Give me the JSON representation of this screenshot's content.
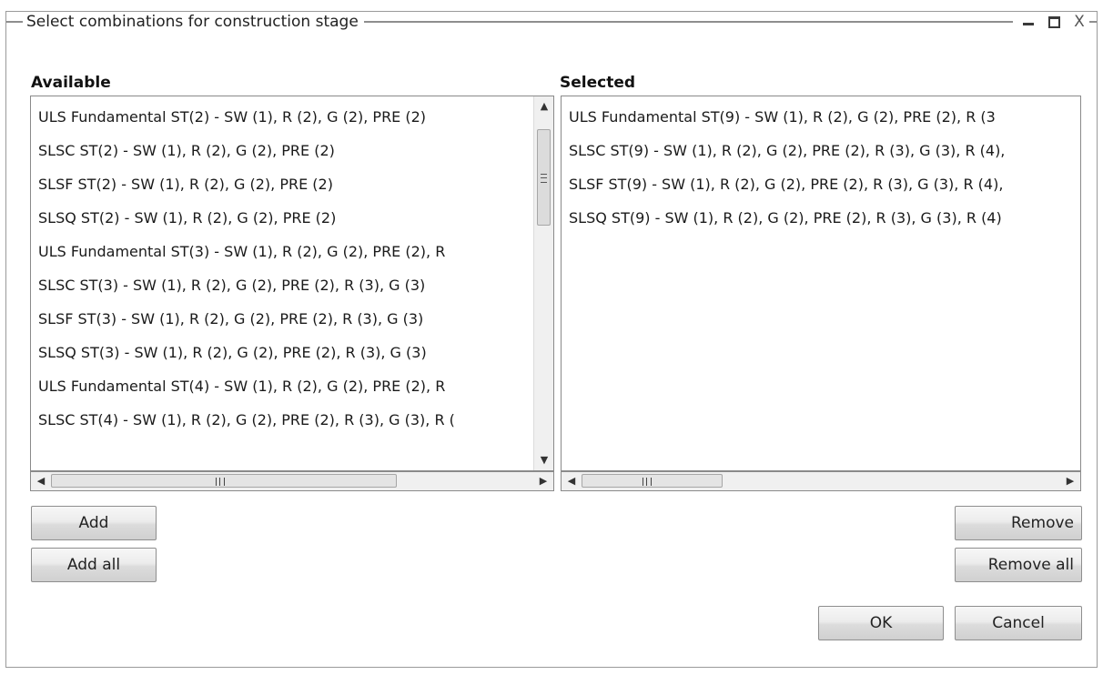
{
  "window": {
    "title": "Select combinations for construction stage",
    "close_glyph": "X",
    "icons": [
      "minimize-icon",
      "maximize-icon",
      "close-icon"
    ]
  },
  "available": {
    "label": "Available",
    "items": [
      "ULS Fundamental ST(2) - SW (1), R (2), G (2), PRE (2)",
      "SLSC ST(2) - SW (1), R (2), G (2), PRE (2)",
      "SLSF ST(2) - SW (1), R (2), G (2), PRE (2)",
      "SLSQ ST(2) - SW (1), R (2), G (2), PRE (2)",
      "ULS Fundamental ST(3) - SW (1), R (2), G (2), PRE (2), R",
      "SLSC ST(3) - SW (1), R (2), G (2), PRE (2), R (3), G (3)",
      "SLSF ST(3) - SW (1), R (2), G (2), PRE (2), R (3), G (3)",
      "SLSQ ST(3) - SW (1), R (2), G (2), PRE (2), R (3), G (3)",
      "ULS Fundamental ST(4) - SW (1), R (2), G (2), PRE (2), R",
      "SLSC ST(4) - SW (1), R (2), G (2), PRE (2), R (3), G (3), R ("
    ]
  },
  "selected": {
    "label": "Selected",
    "items": [
      "ULS Fundamental ST(9) - SW (1), R (2), G (2), PRE (2), R (3",
      "SLSC ST(9) - SW (1), R (2), G (2), PRE (2), R (3), G (3), R (4),",
      "SLSF ST(9) - SW (1), R (2), G (2), PRE (2), R (3), G (3), R (4),",
      "SLSQ ST(9) - SW (1), R (2), G (2), PRE (2), R (3), G (3), R (4)"
    ]
  },
  "buttons": {
    "add": "Add",
    "add_all": "Add all",
    "remove": "Remove",
    "remove_all": "Remove all",
    "ok": "OK",
    "cancel": "Cancel"
  },
  "scroll_glyphs": {
    "up": "▲",
    "down": "▼",
    "left": "◀",
    "right": "▶"
  }
}
